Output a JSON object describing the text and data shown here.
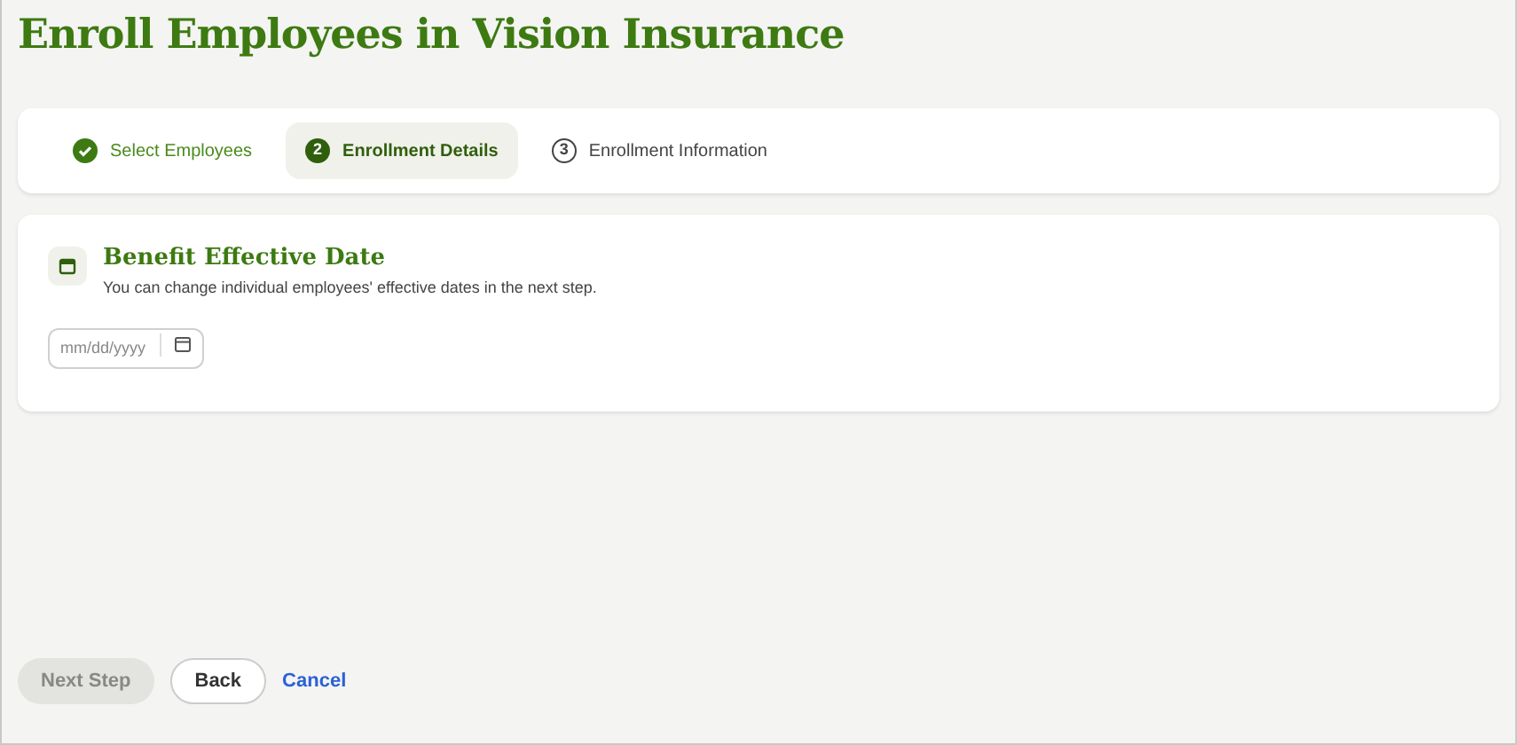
{
  "title": "Enroll Employees in Vision Insurance",
  "steps": [
    {
      "label": "Select Employees",
      "kind": "complete",
      "selected": false
    },
    {
      "label": "Enrollment Details",
      "number": "2",
      "kind": "current",
      "selected": true
    },
    {
      "label": "Enrollment Information",
      "number": "3",
      "kind": "upcoming",
      "selected": false
    }
  ],
  "section": {
    "title": "Benefit Effective Date",
    "description": "You can change individual employees' effective dates in the next step.",
    "date_field": {
      "placeholder": "mm/dd/yyyy"
    }
  },
  "buttons": [
    {
      "label": "Next Step",
      "kind": "primary",
      "disabled": true
    },
    {
      "label": "Back",
      "kind": "secondary",
      "disabled": false
    },
    {
      "label": "Cancel",
      "kind": "link",
      "disabled": false
    }
  ]
}
